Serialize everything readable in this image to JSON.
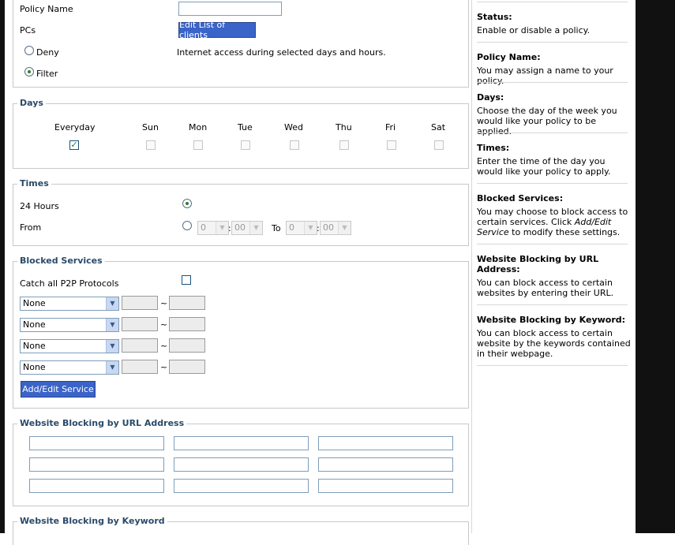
{
  "policy": {
    "policy_name_label": "Policy Name",
    "policy_name_value": "",
    "pcs_label": "PCs",
    "edit_clients_button": "Edit List of clients",
    "deny_label": "Deny",
    "filter_label": "Filter",
    "filter_description": "Internet access during selected days and hours.",
    "selected_mode": "Filter"
  },
  "days": {
    "legend": "Days",
    "items": [
      {
        "label": "Everyday",
        "checked": true
      },
      {
        "label": "Sun",
        "checked": false
      },
      {
        "label": "Mon",
        "checked": false
      },
      {
        "label": "Tue",
        "checked": false
      },
      {
        "label": "Wed",
        "checked": false
      },
      {
        "label": "Thu",
        "checked": false
      },
      {
        "label": "Fri",
        "checked": false
      },
      {
        "label": "Sat",
        "checked": false
      }
    ]
  },
  "times": {
    "legend": "Times",
    "all_day_label": "24 Hours",
    "from_label": "From",
    "to_label": "To",
    "from_hour": "0",
    "from_minute": "00",
    "to_hour": "0",
    "to_minute": "00",
    "colon": ":",
    "selected": "24 Hours"
  },
  "blocked_services": {
    "legend": "Blocked Services",
    "p2p_label": "Catch all P2P Protocols",
    "p2p_checked": false,
    "range_separator": "~",
    "rows": [
      {
        "service": "None",
        "from_port": "",
        "to_port": ""
      },
      {
        "service": "None",
        "from_port": "",
        "to_port": ""
      },
      {
        "service": "None",
        "from_port": "",
        "to_port": ""
      },
      {
        "service": "None",
        "from_port": "",
        "to_port": ""
      }
    ],
    "add_edit_button": "Add/Edit Service"
  },
  "url_blocking": {
    "legend": "Website Blocking by URL Address",
    "urls": [
      "",
      "",
      "",
      "",
      "",
      "",
      "",
      "",
      ""
    ]
  },
  "keyword_blocking": {
    "legend": "Website Blocking by Keyword"
  },
  "help": {
    "status_title": "Status:",
    "status_text": "Enable or disable a policy.",
    "name_title": "Policy Name:",
    "name_text": "You may assign a name to your policy.",
    "days_title": "Days:",
    "days_text": "Choose the day of the week you would like your policy to be applied.",
    "times_title": "Times:",
    "times_text": "Enter the time of the day you would like your policy to apply.",
    "services_title": "Blocked Services:",
    "services_text_1": "You may choose to block access to certain services. Click ",
    "services_text_link": "Add/Edit Service",
    "services_text_2": " to modify these settings.",
    "url_title": "Website Blocking by URL Address:",
    "url_text": "You can block access to certain websites by entering their URL.",
    "keyword_title": "Website Blocking by Keyword:",
    "keyword_text": "You can block access to certain website by the keywords contained in their webpage."
  },
  "colors": {
    "button_blue": "#3b64c8",
    "legend_text": "#2a4a6a",
    "check_green": "#2f7d32"
  }
}
